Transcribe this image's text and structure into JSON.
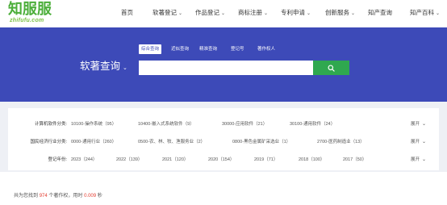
{
  "brand": {
    "name": "知服服",
    "domain": "zhifufu.com",
    "color_green": "#4cae3a"
  },
  "nav": {
    "items": [
      {
        "label": "首页",
        "dropdown": false
      },
      {
        "label": "软著登记",
        "dropdown": true
      },
      {
        "label": "作品登记",
        "dropdown": true
      },
      {
        "label": "商标注册",
        "dropdown": true
      },
      {
        "label": "专利申请",
        "dropdown": true
      },
      {
        "label": "创新服务",
        "dropdown": true
      },
      {
        "label": "知产查询",
        "dropdown": false
      },
      {
        "label": "知产百科",
        "dropdown": true
      }
    ]
  },
  "hero": {
    "background": "#3d4ab8",
    "tabs": [
      "综合查询",
      "近似查询",
      "精准查询",
      "登记号",
      "著作权人"
    ],
    "active_tab": 0,
    "title": "软著查询",
    "search_placeholder": "",
    "search_button_color": "#2fa84f"
  },
  "filters": [
    {
      "label": "计算机软件分类:",
      "options": [
        "10100-操作系统（95）",
        "10400-嵌入式系统软件（9）",
        "30000-应用软件（21）",
        "30100-通用软件（24）"
      ],
      "expand": "展开"
    },
    {
      "label": "国民经济行业分类:",
      "options": [
        "0000-通用行业（260）",
        "0500-农、林、牧、渔服务业（2）",
        "0800-黑色金属矿采选业（1）",
        "2700-医药制造业（13）"
      ],
      "expand": "展开"
    },
    {
      "label": "登记年份:",
      "options": [
        "2023（244）",
        "2022（139）",
        "2021（120）",
        "2020（154）",
        "2019（71）",
        "2018（100）",
        "2017（50）"
      ],
      "expand": "展开"
    }
  ],
  "results": {
    "prefix": "共为您找到",
    "count": "974",
    "middle": "个著作权，用时",
    "time": "0.009",
    "suffix": "秒"
  }
}
